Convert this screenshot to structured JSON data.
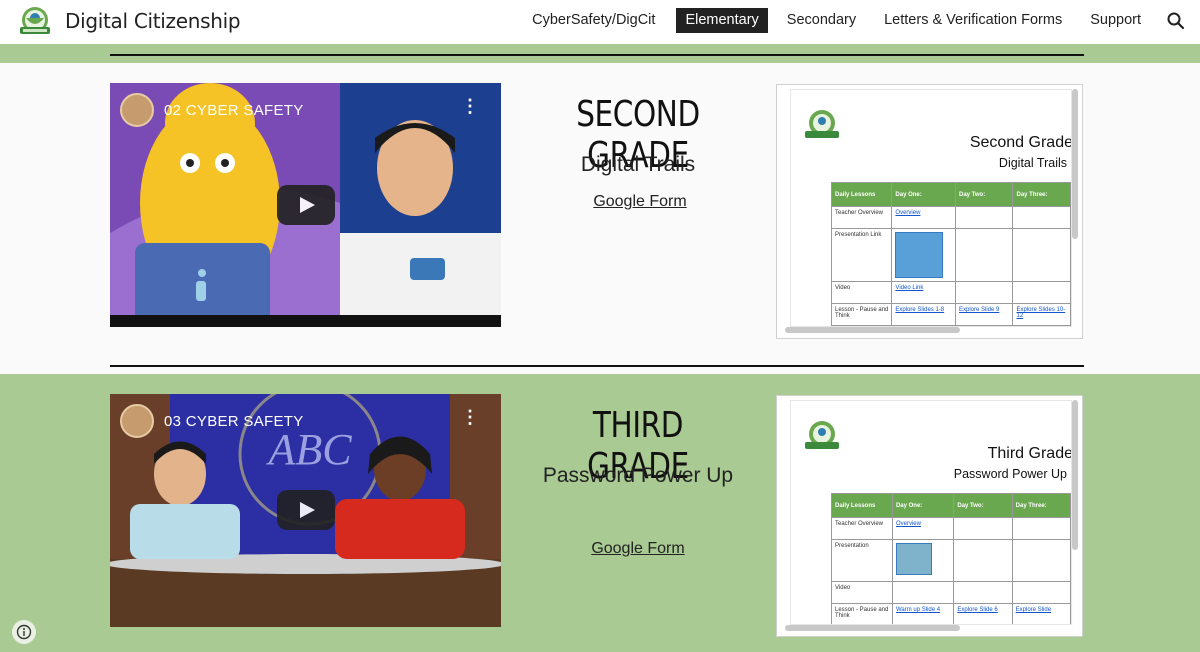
{
  "header": {
    "site_title": "Digital Citizenship",
    "nav": [
      "CyberSafety/DigCit",
      "Elementary",
      "Secondary",
      "Letters & Verification Forms",
      "Support"
    ],
    "active_nav": "Elementary",
    "search_icon": "search-icon"
  },
  "colors": {
    "band_green": "#a9ca93",
    "table_header_green": "#6aa84f",
    "nav_active_bg": "#222222"
  },
  "sections": [
    {
      "grade": "SECOND GRADE",
      "subtitle": "Digital Trails",
      "form_link": "Google Form",
      "video_title": "02 CYBER SAFETY",
      "doc": {
        "heading": "Second Grade",
        "subheading": "Digital Trails",
        "headers": [
          "Daily Lessons",
          "Day One:",
          "Day Two:",
          "Day Three:"
        ],
        "rows": [
          [
            "Teacher Overview",
            "Overview",
            "",
            ""
          ],
          [
            "Presentation Link",
            "",
            "",
            ""
          ],
          [
            "Video",
            "Video Link",
            "",
            ""
          ],
          [
            "Lesson - Pause and Think",
            "Explore Slides 1-8",
            "Explore Slide 9",
            "Explore Slides 10-12"
          ]
        ]
      }
    },
    {
      "grade": "THIRD GRADE",
      "subtitle": "Password Power Up",
      "form_link": "Google Form",
      "video_title": "03 CYBER SAFETY",
      "doc": {
        "heading": "Third Grade",
        "subheading": "Password Power Up",
        "headers": [
          "Daily Lessons",
          "Day One:",
          "Day Two:",
          "Day Three:"
        ],
        "rows": [
          [
            "Teacher Overview",
            "Overview",
            "",
            ""
          ],
          [
            "Presentation",
            "",
            "",
            ""
          ],
          [
            "Video",
            "",
            "",
            ""
          ],
          [
            "Lesson - Pause and Think",
            "Warm up Slide 4",
            "Explore Slide 6",
            "Explore Slide"
          ]
        ]
      }
    }
  ]
}
